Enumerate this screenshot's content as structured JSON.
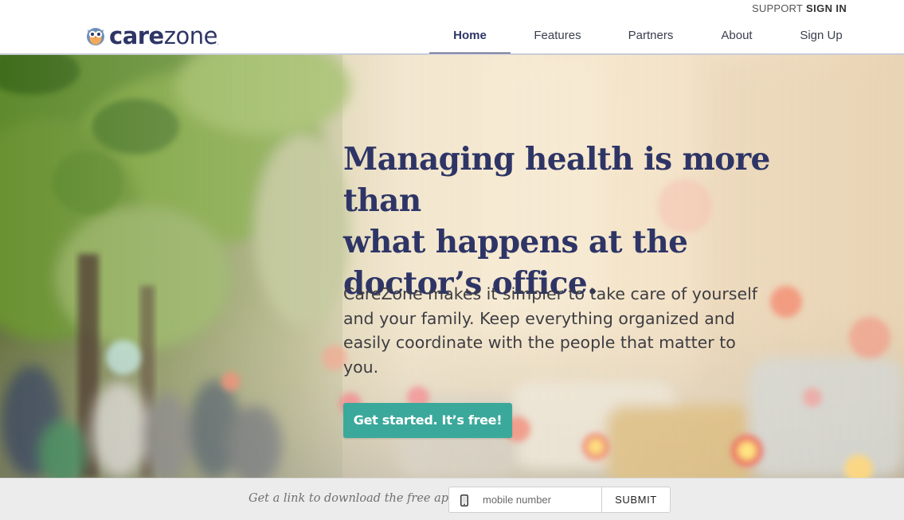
{
  "utility_bar": {
    "support_label": "SUPPORT",
    "signin_label": "SIGN IN"
  },
  "brand": {
    "name_bold": "care",
    "name_light": "zone",
    "trademark": "."
  },
  "nav": {
    "items": [
      {
        "label": "Home",
        "active": true
      },
      {
        "label": "Features",
        "active": false
      },
      {
        "label": "Partners",
        "active": false
      },
      {
        "label": "About",
        "active": false
      },
      {
        "label": "Sign Up",
        "active": false
      }
    ]
  },
  "hero": {
    "headline_line1": "Managing health is more than",
    "headline_line2": "what happens at the",
    "headline_line3": "doctor’s office.",
    "subtext": "CareZone makes it simpler to take care of yourself and your family. Keep everything organized and easily coordinate with the people that matter to you.",
    "cta_label": "Get started. It’s free!"
  },
  "app_download": {
    "prompt": "Get a link to download the free app:",
    "input_placeholder": "mobile number",
    "submit_label": "SUBMIT",
    "icon": "phone-icon"
  },
  "colors": {
    "brand_navy": "#2e3566",
    "cta_teal": "#3aa99b",
    "download_bar_bg": "#ececec"
  }
}
